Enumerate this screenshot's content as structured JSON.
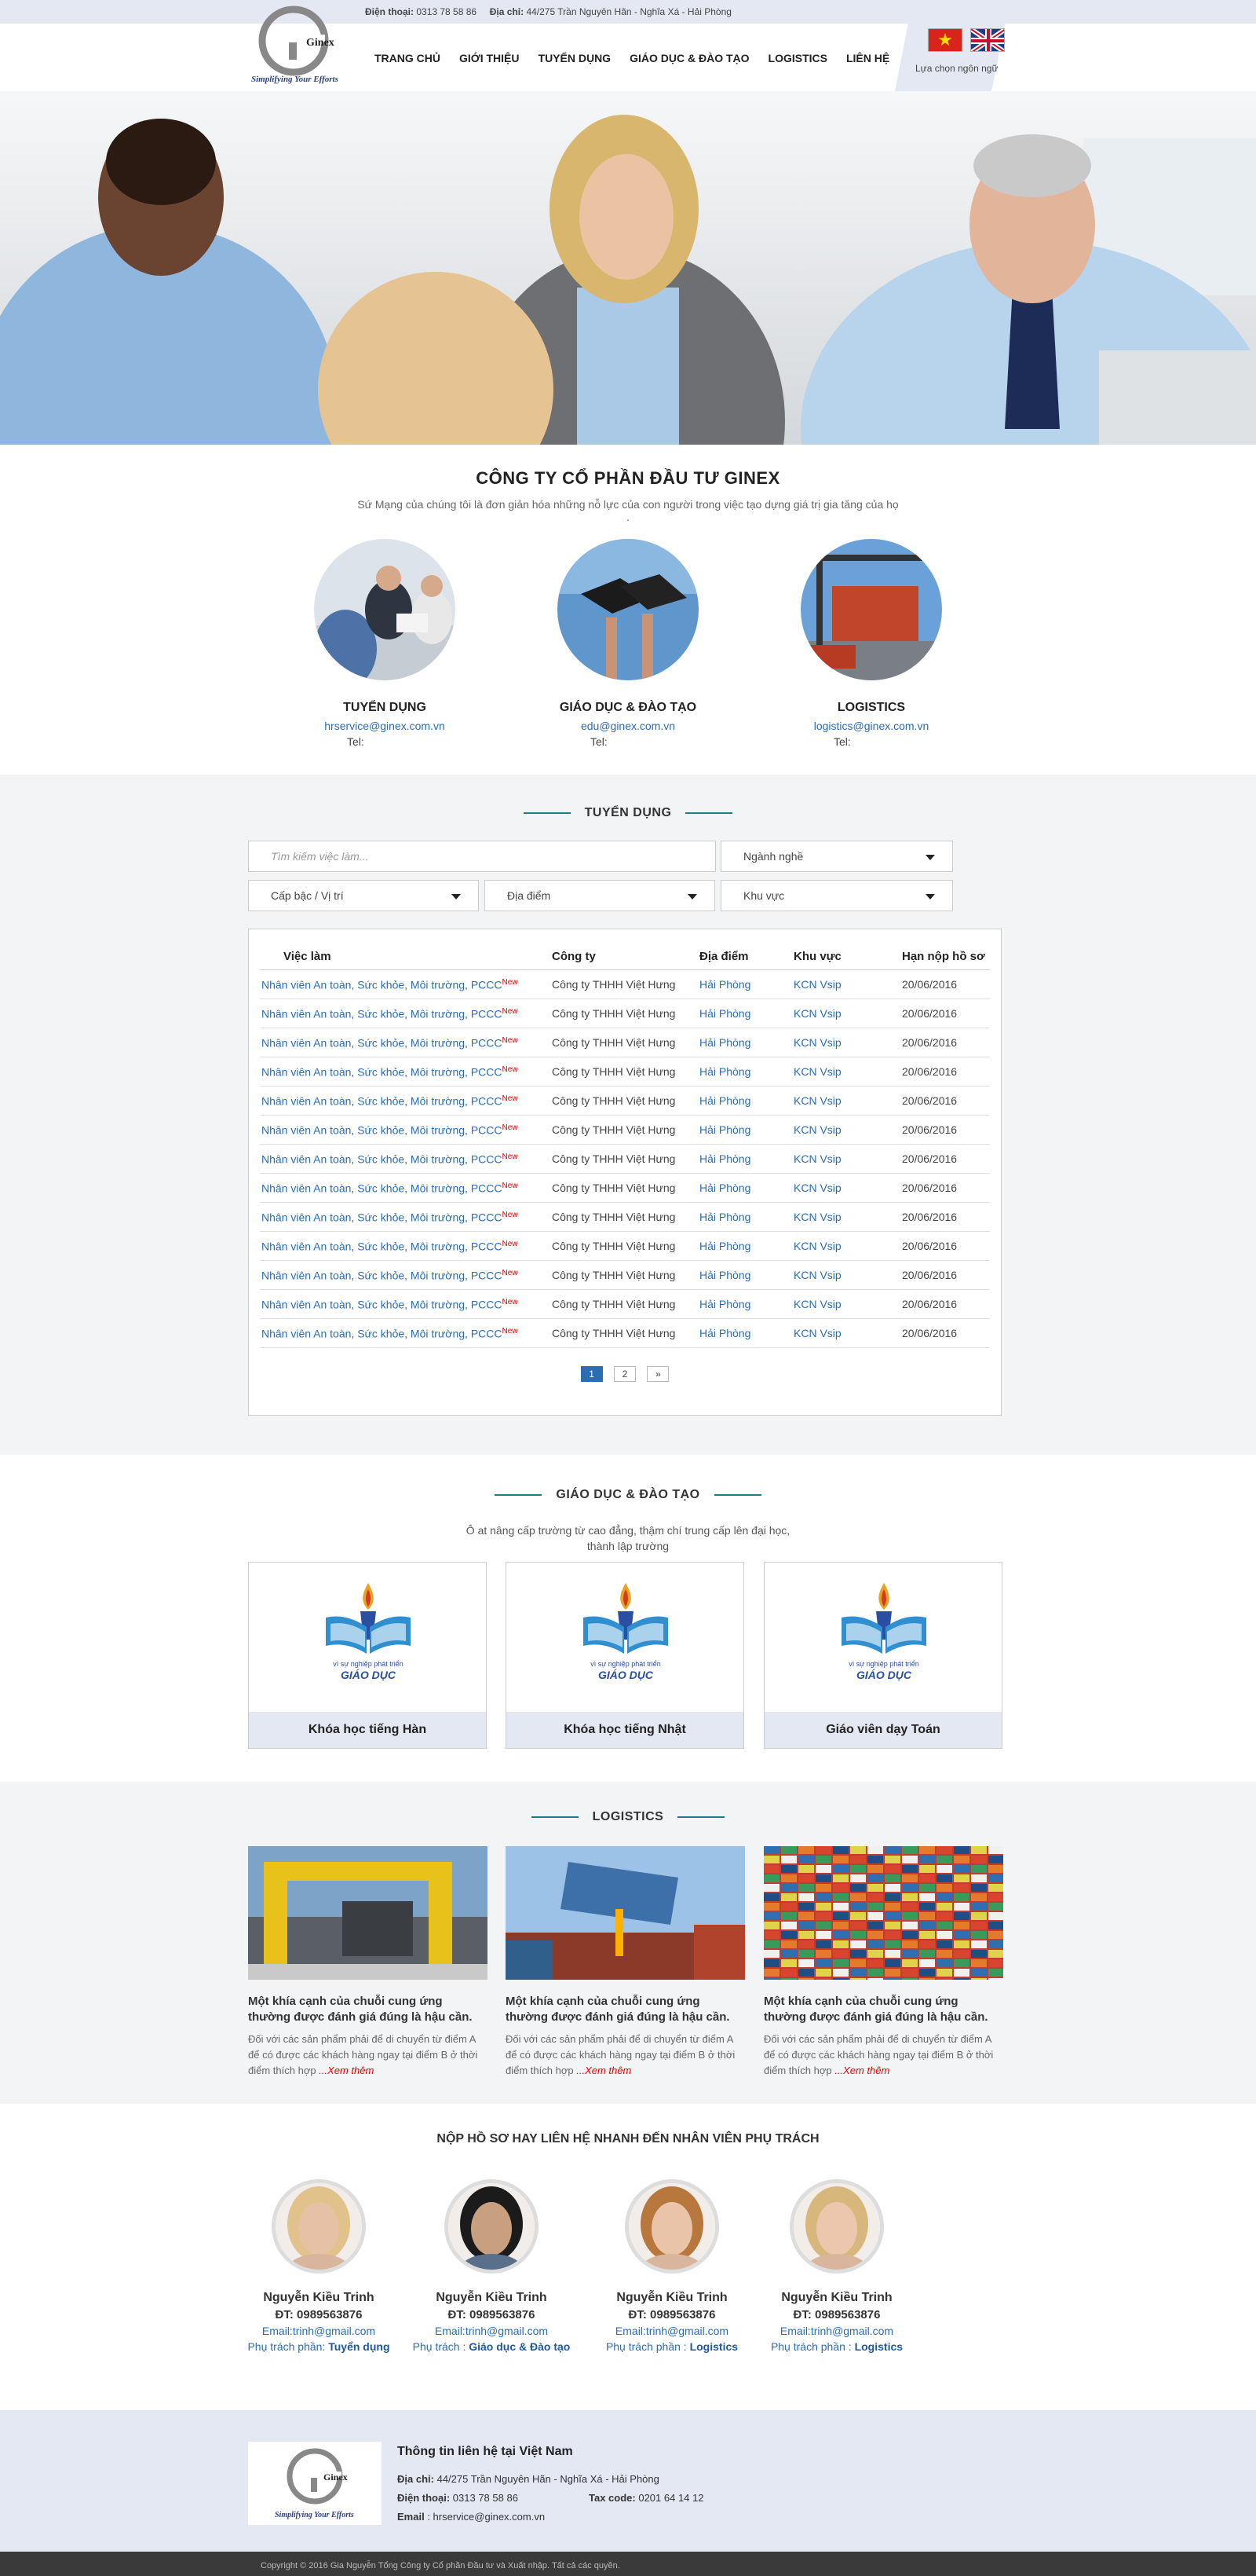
{
  "topbar": {
    "phone_label": "Điện thoại:",
    "phone": "0313 78 58 86",
    "address_label": "Địa chỉ:",
    "address": "44/275 Trần Nguyên Hãn - Nghĩa Xá - Hải Phòng"
  },
  "logo": {
    "name": "Ginex",
    "tagline": "Simplifying Your Efforts"
  },
  "nav": [
    "TRANG CHỦ",
    "GIỚI THIỆU",
    "TUYỂN DỤNG",
    "GIÁO DỤC & ĐÀO TẠO",
    "LOGISTICS",
    "LIÊN HỆ"
  ],
  "language": {
    "label": "Lựa chọn ngôn ngữ"
  },
  "intro": {
    "title": "CÔNG TY CỔ PHẦN ĐẦU TƯ GINEX",
    "subtitle": "Sứ Mạng của chúng tôi là đơn giản hóa những nỗ lực của con người trong việc tạo dựng giá trị gia tăng của họ",
    "dot": "."
  },
  "services": [
    {
      "title": "TUYỂN DỤNG",
      "email": "hrservice@ginex.com.vn",
      "tel": "Tel:"
    },
    {
      "title": "GIÁO DỤC & ĐÀO TẠO",
      "email": "edu@ginex.com.vn",
      "tel": "Tel:"
    },
    {
      "title": "LOGISTICS",
      "email": "logistics@ginex.com.vn",
      "tel": "Tel:"
    }
  ],
  "recruit": {
    "title": "TUYỂN DỤNG",
    "search_placeholder": "Tìm kiếm việc làm...",
    "filters": {
      "industry": "Ngành nghề",
      "level": "Cấp bậc / Vị trí",
      "location": "Địa điểm",
      "area": "Khu vực"
    },
    "columns": [
      "Việc làm",
      "Công ty",
      "Địa điểm",
      "Khu vực",
      "Hạn nộp hồ sơ"
    ],
    "new_badge": "New",
    "rows": [
      {
        "job": "Nhân viên An toàn, Sức khỏe, Môi trường, PCCC",
        "company": "Công ty THHH Việt Hưng",
        "location": "Hải Phòng",
        "area": "KCN Vsip",
        "deadline": "20/06/2016"
      },
      {
        "job": "Nhân viên An toàn, Sức khỏe, Môi trường, PCCC",
        "company": "Công ty THHH Việt Hưng",
        "location": "Hải Phòng",
        "area": "KCN Vsip",
        "deadline": "20/06/2016"
      },
      {
        "job": "Nhân viên An toàn, Sức khỏe, Môi trường, PCCC",
        "company": "Công ty THHH Việt Hưng",
        "location": "Hải Phòng",
        "area": "KCN Vsip",
        "deadline": "20/06/2016"
      },
      {
        "job": "Nhân viên An toàn, Sức khỏe, Môi trường, PCCC",
        "company": "Công ty THHH Việt Hưng",
        "location": "Hải Phòng",
        "area": "KCN Vsip",
        "deadline": "20/06/2016"
      },
      {
        "job": "Nhân viên An toàn, Sức khỏe, Môi trường, PCCC",
        "company": "Công ty THHH Việt Hưng",
        "location": "Hải Phòng",
        "area": "KCN Vsip",
        "deadline": "20/06/2016"
      },
      {
        "job": "Nhân viên An toàn, Sức khỏe, Môi trường, PCCC",
        "company": "Công ty THHH Việt Hưng",
        "location": "Hải Phòng",
        "area": "KCN Vsip",
        "deadline": "20/06/2016"
      },
      {
        "job": "Nhân viên An toàn, Sức khỏe, Môi trường, PCCC",
        "company": "Công ty THHH Việt Hưng",
        "location": "Hải Phòng",
        "area": "KCN Vsip",
        "deadline": "20/06/2016"
      },
      {
        "job": "Nhân viên An toàn, Sức khỏe, Môi trường, PCCC",
        "company": "Công ty THHH Việt Hưng",
        "location": "Hải Phòng",
        "area": "KCN Vsip",
        "deadline": "20/06/2016"
      },
      {
        "job": "Nhân viên An toàn, Sức khỏe, Môi trường, PCCC",
        "company": "Công ty THHH Việt Hưng",
        "location": "Hải Phòng",
        "area": "KCN Vsip",
        "deadline": "20/06/2016"
      },
      {
        "job": "Nhân viên An toàn, Sức khỏe, Môi trường, PCCC",
        "company": "Công ty THHH Việt Hưng",
        "location": "Hải Phòng",
        "area": "KCN Vsip",
        "deadline": "20/06/2016"
      },
      {
        "job": "Nhân viên An toàn, Sức khỏe, Môi trường, PCCC",
        "company": "Công ty THHH Việt Hưng",
        "location": "Hải Phòng",
        "area": "KCN Vsip",
        "deadline": "20/06/2016"
      },
      {
        "job": "Nhân viên An toàn, Sức khỏe, Môi trường, PCCC",
        "company": "Công ty THHH Việt Hưng",
        "location": "Hải Phòng",
        "area": "KCN Vsip",
        "deadline": "20/06/2016"
      },
      {
        "job": "Nhân viên An toàn, Sức khỏe, Môi trường, PCCC",
        "company": "Công ty THHH Việt Hưng",
        "location": "Hải Phòng",
        "area": "KCN Vsip",
        "deadline": "20/06/2016"
      }
    ],
    "pager": [
      "1",
      "2",
      "»"
    ]
  },
  "edu": {
    "title": "GIÁO DỤC & ĐÀO TẠO",
    "subtitle_1": "Ô at nâng cấp trường từ cao đẳng, thậm chí trung cấp lên đại học,",
    "subtitle_2": "thành lập trường",
    "logo_text_1": "vì sự nghiệp phát triển",
    "logo_text_2": "GIÁO DỤC",
    "courses": [
      "Khóa học tiếng Hàn",
      "Khóa học tiếng Nhật",
      "Giáo viên dạy Toán"
    ]
  },
  "logistics": {
    "title": "LOGISTICS",
    "cards": [
      {
        "heading": "Một khía cạnh của chuỗi cung ứng thường được đánh giá đúng là hậu cần.",
        "body": "Đối với các sản phẩm phải để di chuyển từ điểm A để có được các khách hàng ngay tại điểm B ở thời điểm thích hợp",
        "more": "...Xem thêm"
      },
      {
        "heading": "Một khía cạnh của chuỗi cung ứng thường được đánh giá đúng là hậu cần.",
        "body": "Đối với các sản phẩm phải để di chuyển từ điểm A để có được các khách hàng ngay tại điểm B ở thời điểm thích hợp",
        "more": "...Xem thêm"
      },
      {
        "heading": "Một khía cạnh của chuỗi cung ứng thường được đánh giá đúng là hậu cần.",
        "body": "Đối với các sản phẩm phải để di chuyển từ điểm A để có được các khách hàng ngay tại điểm B ở thời điểm thích hợp",
        "more": "...Xem thêm"
      }
    ]
  },
  "contacts": {
    "title": "NỘP HỒ SƠ HAY LIÊN HỆ NHANH ĐẾN NHÂN VIÊN PHỤ TRÁCH",
    "people": [
      {
        "name": "Nguyễn Kiều Trinh",
        "phone": "ĐT: 0989563876",
        "email": "Email:trinh@gmail.com",
        "duty_label": "Phụ trách phần:",
        "duty": "Tuyển dụng"
      },
      {
        "name": "Nguyễn Kiều Trinh",
        "phone": "ĐT: 0989563876",
        "email": "Email:trinh@gmail.com",
        "duty_label": "Phụ trách :",
        "duty": "Giáo dục & Đào tạo"
      },
      {
        "name": "Nguyễn Kiều Trinh",
        "phone": "ĐT: 0989563876",
        "email": "Email:trinh@gmail.com",
        "duty_label": "Phụ trách phần :",
        "duty": "Logistics"
      },
      {
        "name": "Nguyễn Kiều Trinh",
        "phone": "ĐT: 0989563876",
        "email": "Email:trinh@gmail.com",
        "duty_label": "Phụ trách phần :",
        "duty": "Logistics"
      }
    ]
  },
  "footer": {
    "title": "Thông tin liên hệ tại Việt Nam",
    "address_label": "Địa chỉ:",
    "address": "44/275 Trần Nguyên Hãn - Nghĩa Xá - Hải Phòng",
    "phone_label": "Điện thoại:",
    "phone": "0313 78 58 86",
    "tax_label": "Tax code:",
    "tax": "0201 64 14 12",
    "email_label": "Email",
    "email": ": hrservice@ginex.com.vn",
    "copyright": "Copyright © 2016 Gia Nguyễn Tổng Công ty Cổ phần Đầu tư và Xuất nhập. Tất cả các quyền."
  },
  "colors": {
    "accent": "#2a6db5",
    "teal_line": "#1f7a8c",
    "light_bg": "#e3e8f3",
    "gray_bg": "#f3f4f6",
    "new_red": "#e00000"
  }
}
